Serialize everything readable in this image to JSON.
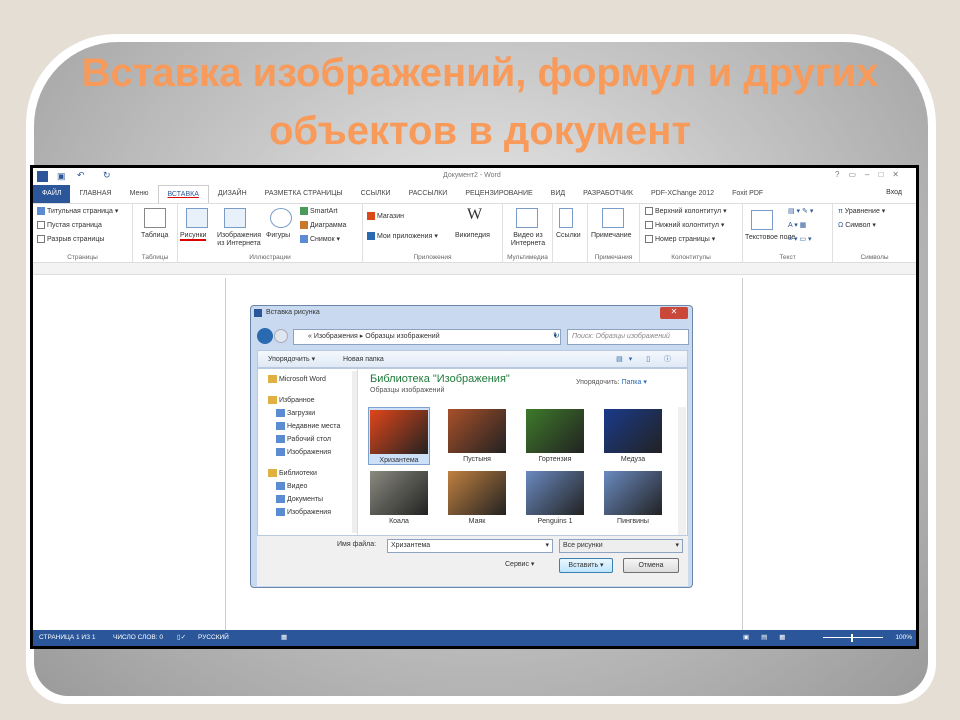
{
  "slide": {
    "title": "Вставка изображений, формул и других объектов в документ",
    "title_color": "#f79a5a"
  },
  "word": {
    "window_title": "Документ2 - Word",
    "signin": "Вход",
    "tabs": [
      "ФАЙЛ",
      "ГЛАВНАЯ",
      "Меню",
      "ВСТАВКА",
      "ДИЗАЙН",
      "РАЗМЕТКА СТРАНИЦЫ",
      "ССЫЛКИ",
      "РАССЫЛКИ",
      "РЕЦЕНЗИРОВАНИЕ",
      "ВИД",
      "РАЗРАБОТЧИК",
      "PDF-XChange 2012",
      "Foxit PDF"
    ],
    "active_tab": "ВСТАВКА",
    "ribbon": {
      "pages": {
        "items": [
          "Титульная страница",
          "Пустая страница",
          "Разрыв страницы"
        ],
        "label": "Страницы"
      },
      "tables": {
        "button": "Таблица",
        "label": "Таблицы"
      },
      "illustrations": {
        "pictures": "Рисунки",
        "online": "Изображения из Интернета",
        "shapes": "Фигуры",
        "smartart": "SmartArt",
        "chart": "Диаграмма",
        "screenshot": "Снимок",
        "label": "Иллюстрации"
      },
      "apps": {
        "store": "Магазин",
        "myapps": "Мои приложения",
        "wiki": "Википедия",
        "label": "Приложения"
      },
      "media": {
        "video": "Видео из Интернета",
        "label": "Мультимедиа"
      },
      "links": {
        "button": "Ссылки"
      },
      "comments": {
        "button": "Примечание",
        "label": "Примечания"
      },
      "headers": {
        "items": [
          "Верхний колонтитул",
          "Нижний колонтитул",
          "Номер страницы"
        ],
        "label": "Колонтитулы"
      },
      "text": {
        "textbox": "Текстовое поле",
        "label": "Текст"
      },
      "symbols": {
        "items": [
          "Уравнение",
          "Символ"
        ],
        "label": "Символы"
      }
    },
    "status": {
      "page": "СТРАНИЦА 1 ИЗ 1",
      "words": "ЧИСЛО СЛОВ: 0",
      "lang": "РУССКИЙ",
      "zoom": "100%"
    },
    "accent": "#2b579a"
  },
  "dialog": {
    "title": "Вставка рисунка",
    "path": [
      "Изображения",
      "Образцы изображений"
    ],
    "search_placeholder": "Поиск: Образцы изображений",
    "organize": "Упорядочить",
    "new_folder": "Новая папка",
    "sidebar": [
      {
        "label": "Microsoft Word",
        "group": true
      },
      {
        "label": "Избранное",
        "group": true
      },
      {
        "label": "Загрузки"
      },
      {
        "label": "Недавние места"
      },
      {
        "label": "Рабочий стол"
      },
      {
        "label": "Изображения"
      },
      {
        "label": "Библиотеки",
        "group": true
      },
      {
        "label": "Видео"
      },
      {
        "label": "Документы"
      },
      {
        "label": "Изображения"
      }
    ],
    "library_title": "Библиотека \"Изображения\"",
    "library_sub": "Образцы изображений",
    "arrange_label": "Упорядочить:",
    "arrange_value": "Папка",
    "files": [
      {
        "name": "Хризантема",
        "selected": true
      },
      {
        "name": "Пустыня"
      },
      {
        "name": "Гортензия"
      },
      {
        "name": "Медуза"
      },
      {
        "name": "Коала"
      },
      {
        "name": "Маяк"
      },
      {
        "name": "Penguins 1"
      },
      {
        "name": "Пингвины"
      }
    ],
    "filename_label": "Имя файла:",
    "filename_value": "Хризантема",
    "filter": "Все рисунки",
    "tools": "Сервис",
    "insert": "Вставить",
    "cancel": "Отмена"
  }
}
